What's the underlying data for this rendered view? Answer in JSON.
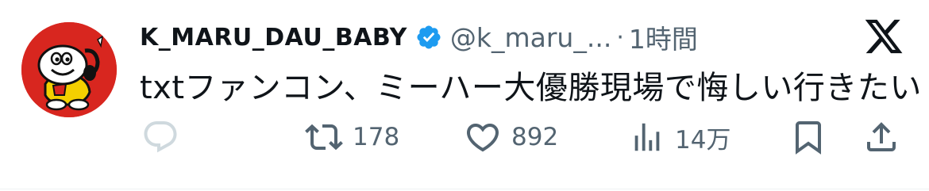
{
  "tweet": {
    "display_name": "K_MARU_DAU_BABY",
    "handle": "@k_maru_...",
    "separator": "·",
    "time": "1時間",
    "text": "txtファンコン、ミーハー大優勝現場で悔しい行きたい"
  },
  "actions": {
    "retweet_count": "178",
    "like_count": "892",
    "view_count": "14万"
  },
  "icons": [
    "avatar",
    "verified-badge-icon",
    "x-logo-icon",
    "reply-icon",
    "retweet-icon",
    "like-icon",
    "views-icon",
    "bookmark-icon",
    "share-icon"
  ],
  "colors": {
    "text": "#0f1419",
    "secondary": "#536471",
    "verified": "#1d9bf0",
    "avatar_bg": "#d8261f",
    "reply_icon": "#cfd9de"
  }
}
